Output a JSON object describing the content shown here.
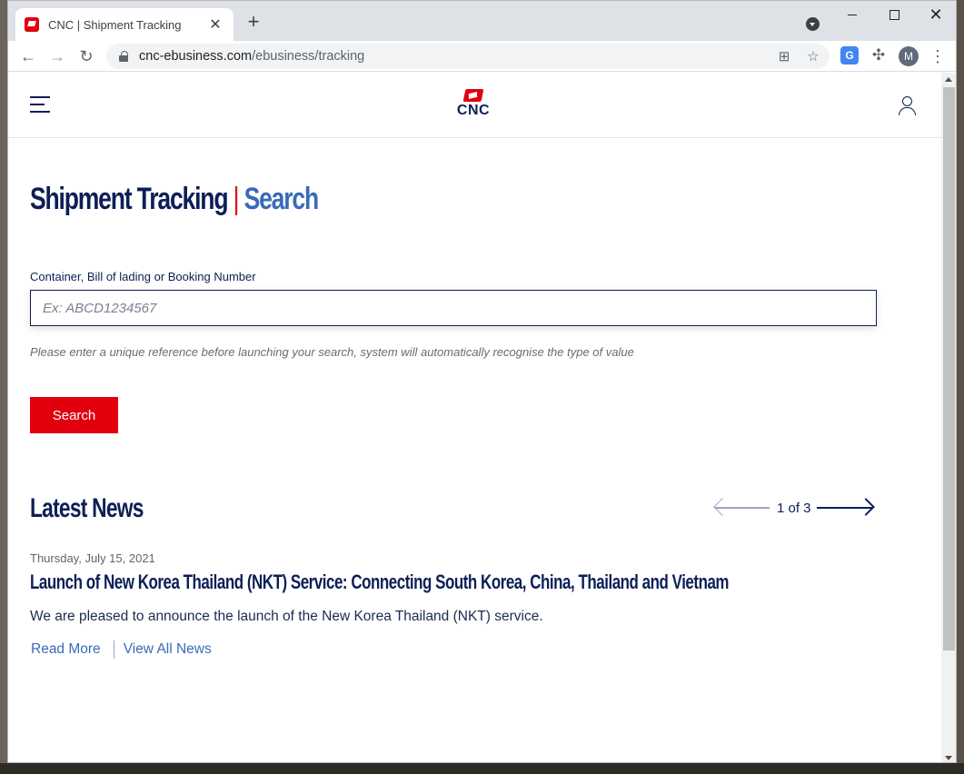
{
  "browser": {
    "tab_title": "CNC | Shipment Tracking",
    "tab_close": "✕",
    "new_tab": "+",
    "url_host": "cnc-ebusiness.com",
    "url_path": "/ebusiness/tracking",
    "profile_initial": "M",
    "window_close": "✕"
  },
  "header": {
    "logo_text": "CNC"
  },
  "page": {
    "title_main": "Shipment Tracking",
    "title_separator": "|",
    "title_sub": "Search"
  },
  "search": {
    "label": "Container, Bill of lading or Booking Number",
    "placeholder": "Ex: ABCD1234567",
    "value": "",
    "hint": "Please enter a unique reference before launching your search, system will automatically recognise the type of value",
    "button_label": "Search"
  },
  "news": {
    "section_title": "Latest News",
    "pager_text": "1 of 3",
    "date": "Thursday, July 15, 2021",
    "headline": "Launch of New Korea Thailand (NKT) Service: Connecting South Korea, China, Thailand and Vietnam",
    "body": "We are pleased to announce the launch of the New Korea Thailand (NKT) service.",
    "read_more": "Read More",
    "view_all": "View All News"
  },
  "colors": {
    "brand_navy": "#0c1f56",
    "brand_red": "#e2000f",
    "link_blue": "#3a6bb8"
  }
}
